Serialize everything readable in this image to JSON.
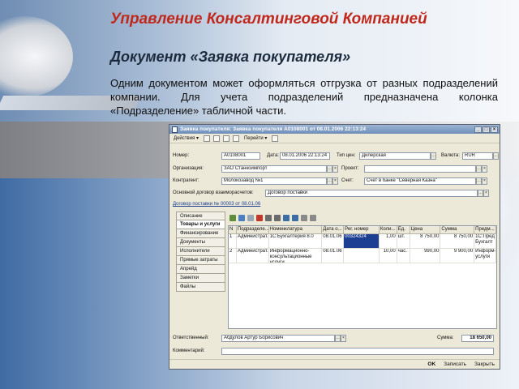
{
  "slide": {
    "header": "Управление Консалтинговой Компанией",
    "doc_title": "Документ «Заявка покупателя»",
    "description": "Одним документом может оформляться отгрузка от разных подразделений компании. Для учета подразделений предназначена колонка «Подразделение» табличной части."
  },
  "window": {
    "title": "Заявка покупателя: Заявка покупателя А0108001 от 08.01.2006 22:13:24",
    "controls": [
      "_",
      "□",
      "×"
    ],
    "toolbar": {
      "actions": "Действия ▾",
      "goto": "Перейти ▾"
    },
    "form": {
      "number_label": "Номер:",
      "number": "А0108001",
      "date_label": "Дата:",
      "date": "08.01.2006 22:13:24",
      "price_type_label": "Тип цен:",
      "price_type": "Дилерская",
      "currency_label": "Валюта:",
      "currency": "RUR",
      "org_label": "Организация:",
      "org": "ЗАО Станкоимпорт",
      "project_label": "Проект:",
      "project": "",
      "counterparty_label": "Контрагент:",
      "counterparty": "Молокозавод №1",
      "account_label": "Счет:",
      "account": "Счет в банке \"Северная Казна\"",
      "contract_main_label": "Основной договор взаиморасчетов:",
      "contract_main": "Договор поставки",
      "contract": "Договор поставки № 00003 от 08.01.06"
    },
    "tabs": [
      "Описание",
      "Товары и услуги",
      "Финансирование",
      "Документы",
      "Исполнители",
      "Прямые затраты",
      "Апрейд",
      "Заметки",
      "Файлы"
    ],
    "grid": {
      "headers": [
        "N",
        "Подразделе...",
        "Номенклатура",
        "Дата о...",
        "Рег. номер",
        "Коли...",
        "Ед.",
        "Цена",
        "Сумма",
        "Предм..."
      ],
      "rows": [
        [
          "1",
          "Администрат...",
          "1С:Бухгалтерия 8.0",
          "08.01.06",
          "00324324",
          "1,00",
          "шт.",
          "8 750,00",
          "8 750,00",
          "1С:Пред Бухгалт"
        ],
        [
          "2",
          "Администрат...",
          "Информационно-консультационные услуги",
          "08.01.06",
          "",
          "10,00",
          "час.",
          "990,00",
          "9 900,00",
          "Информ-услуги"
        ]
      ]
    },
    "responsible_label": "Ответственный:",
    "responsible": "Абдулов Артур Борисович",
    "total_label": "Сумма:",
    "total": "18 650,00",
    "comment_label": "Комментарий:",
    "comment": "",
    "buttons": {
      "ok": "OK",
      "save": "Записать",
      "close": "Закрыть"
    }
  }
}
